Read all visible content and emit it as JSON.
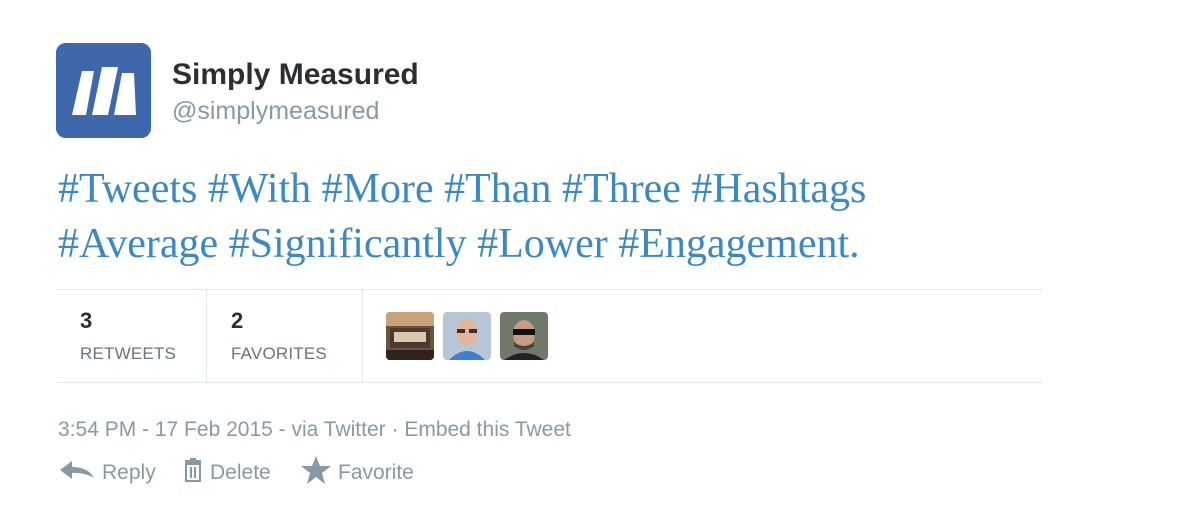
{
  "user": {
    "name": "Simply Measured",
    "handle": "@simplymeasured",
    "avatar_color": "#3e68ab"
  },
  "tweet": {
    "hashtags_line1": [
      "#Tweets",
      "#With",
      "#More",
      "#Than",
      "#Three",
      "#Hashtags"
    ],
    "hashtags_line2": [
      "#Average",
      "#Significantly",
      "#Lower",
      "#Engagement."
    ],
    "link_color": "#3b88c3"
  },
  "stats": {
    "retweets_count": "3",
    "retweets_label": "RETWEETS",
    "favorites_count": "2",
    "favorites_label": "FAVORITES"
  },
  "meta": {
    "timestamp": "3:54 PM - 17 Feb 2015",
    "sep1": " - ",
    "via": "via Twitter",
    "sep2": " · ",
    "embed": "Embed this Tweet"
  },
  "actions": {
    "reply": "Reply",
    "delete": "Delete",
    "favorite": "Favorite"
  }
}
